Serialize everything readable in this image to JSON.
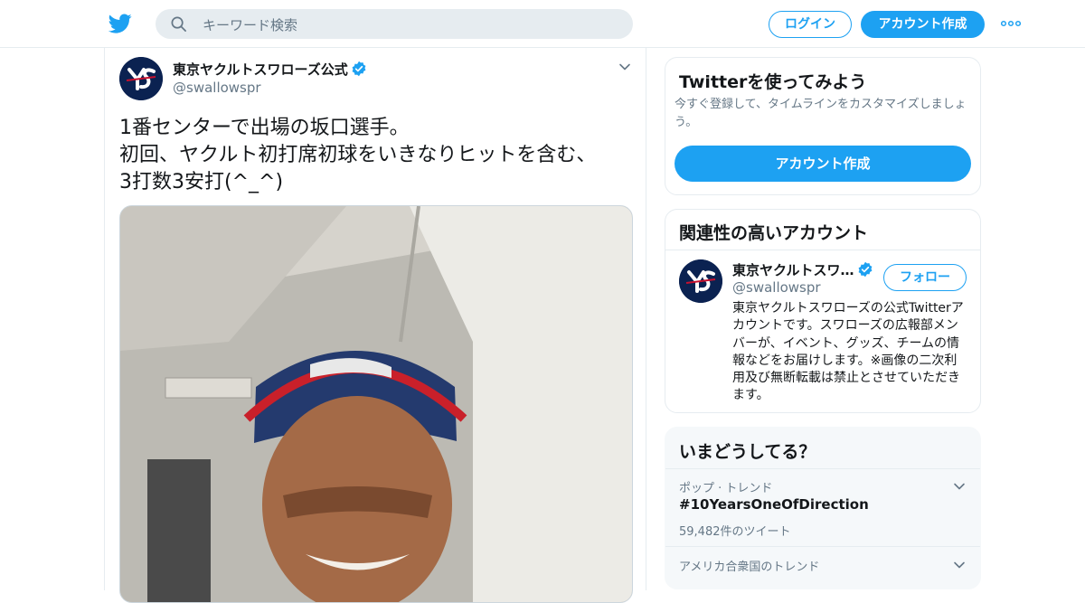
{
  "nav": {
    "search_placeholder": "キーワード検索",
    "login_label": "ログイン",
    "signup_label": "アカウント作成",
    "brand_color": "#1da1f2"
  },
  "tweet": {
    "author_name": "東京ヤクルトスワローズ公式",
    "author_handle": "@swallowspr",
    "text": "1番センターで出場の坂口選手。\n初回、ヤクルト初打席初球をいきなりヒットを含む、\n3打数3安打(^_^)"
  },
  "sidebar": {
    "signup_card": {
      "title": "Twitterを使ってみよう",
      "subtitle": "今すぐ登録して、タイムラインをカスタマイズしましょう。",
      "button_label": "アカウント作成"
    },
    "related": {
      "title": "関連性の高いアカウント",
      "account_name": "東京ヤクルトスワ…",
      "account_handle": "@swallowspr",
      "follow_label": "フォロー",
      "bio": "東京ヤクルトスワローズの公式Twitterアカウントです。スワローズの広報部メンバーが、イベント、グッズ、チームの情報などをお届けします。※画像の二次利用及び無断転載は禁止とさせていただきます。"
    },
    "trends": {
      "title": "いまどうしてる？",
      "items": [
        {
          "category": "ポップ · トレンド",
          "name": "#10YearsOneOfDirection",
          "count": "59,482件のツイート"
        },
        {
          "category": "アメリカ合衆国のトレンド"
        }
      ]
    }
  }
}
